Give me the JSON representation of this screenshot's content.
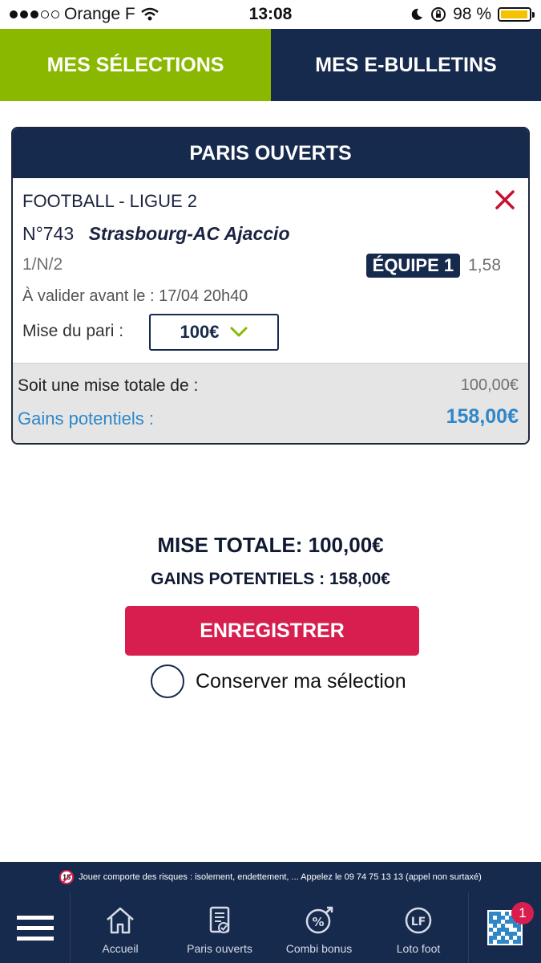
{
  "status_bar": {
    "carrier": "Orange F",
    "time": "13:08",
    "battery": "98 %",
    "battery_level": 0.98,
    "signal_dots_filled": 3,
    "signal_dots_total": 5
  },
  "tabs": [
    {
      "label": "MES SÉLECTIONS",
      "active": true
    },
    {
      "label": "MES E-BULLETINS",
      "active": false
    }
  ],
  "bet_card": {
    "header": "PARIS OUVERTS",
    "league": "FOOTBALL - LIGUE 2",
    "match_number": "N°743",
    "match": "Strasbourg-AC Ajaccio",
    "bet_type": "1/N/2",
    "choice": "ÉQUIPE 1",
    "odds": "1,58",
    "deadline": "À valider avant le : 17/04 20h40",
    "stake_label": "Mise du pari :",
    "stake_value": "100€",
    "total_label": "Soit une mise totale de :",
    "total_value": "100,00€",
    "gains_label": "Gains potentiels :",
    "gains_value": "158,00€"
  },
  "summary": {
    "total": "MISE TOTALE: 100,00€",
    "gains": "GAINS POTENTIELS : 158,00€",
    "save_button": "ENREGISTRER",
    "keep_selection": "Conserver ma sélection"
  },
  "warning": {
    "age": "18",
    "text": "Jouer comporte des risques : isolement, endettement, ... Appelez le 09 74 75 13 13 (appel non surtaxé)"
  },
  "bottom_nav": {
    "items": [
      {
        "label": "Accueil",
        "icon": "home-icon"
      },
      {
        "label": "Paris ouverts",
        "icon": "bet-slip-icon"
      },
      {
        "label": "Combi bonus",
        "icon": "combi-bonus-icon"
      },
      {
        "label": "Loto foot",
        "icon": "loto-foot-icon"
      }
    ],
    "qr_badge": "1"
  },
  "colors": {
    "navy": "#162a4d",
    "green": "#8ab800",
    "red": "#d81e4f",
    "blue": "#2f87c8"
  }
}
